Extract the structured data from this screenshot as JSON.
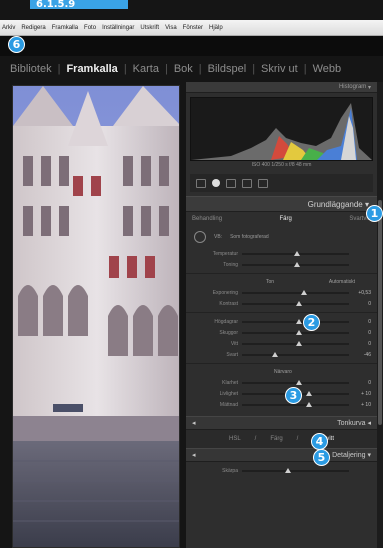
{
  "top_badge": "6.1.5.9",
  "menubar": {
    "items": [
      "Arkiv",
      "Redigera",
      "Framkalla",
      "Foto",
      "Inställningar",
      "Utskrift",
      "Visa",
      "Fönster",
      "Hjälp"
    ]
  },
  "callouts": [
    "1",
    "2",
    "3",
    "4",
    "5",
    "6"
  ],
  "modules": {
    "items": [
      {
        "label": "Bibliotek",
        "active": false
      },
      {
        "label": "Framkalla",
        "active": true
      },
      {
        "label": "Karta",
        "active": false
      },
      {
        "label": "Bok",
        "active": false
      },
      {
        "label": "Bildspel",
        "active": false
      },
      {
        "label": "Skriv ut",
        "active": false
      },
      {
        "label": "Webb",
        "active": false
      }
    ]
  },
  "histogram": {
    "title": "Histogram",
    "readout": "ISO 400 1/250 s f/8 48 mm"
  },
  "grundlaggande": {
    "title": "Grundläggande",
    "treatment_tabs": [
      "Behandling",
      "Färg",
      "Svartvitt"
    ],
    "wb_label": "VB:",
    "wb_value": "Som fotograferad",
    "temp_label": "Temperatur",
    "tint_label": "Toning",
    "tone_label": "Ton",
    "auto_label": "Automatiskt",
    "sliders_tone": [
      {
        "label": "Exponering",
        "value": "+0,53",
        "position": 0.55
      },
      {
        "label": "Kontrast",
        "value": "0",
        "position": 0.5
      }
    ],
    "sliders_hl": [
      {
        "label": "Högdagrar",
        "value": "0",
        "position": 0.5
      },
      {
        "label": "Skuggor",
        "value": "0",
        "position": 0.5
      },
      {
        "label": "Vitt",
        "value": "0",
        "position": 0.5
      },
      {
        "label": "Svart",
        "value": "-46",
        "position": 0.28
      }
    ],
    "presence_label": "Närvaro",
    "sliders_presence": [
      {
        "label": "Klarhet",
        "value": "0",
        "position": 0.5
      },
      {
        "label": "Livlighet",
        "value": "+ 10",
        "position": 0.6
      },
      {
        "label": "Mättnad",
        "value": "+ 10",
        "position": 0.6
      }
    ]
  },
  "collapsed_panels": [
    {
      "title": "Tonkurva"
    },
    {
      "title": "Detaljering"
    }
  ],
  "hsl_tabs": [
    "HSL",
    "Färg",
    "Svartvitt"
  ],
  "bottom_label": "Skärpa"
}
